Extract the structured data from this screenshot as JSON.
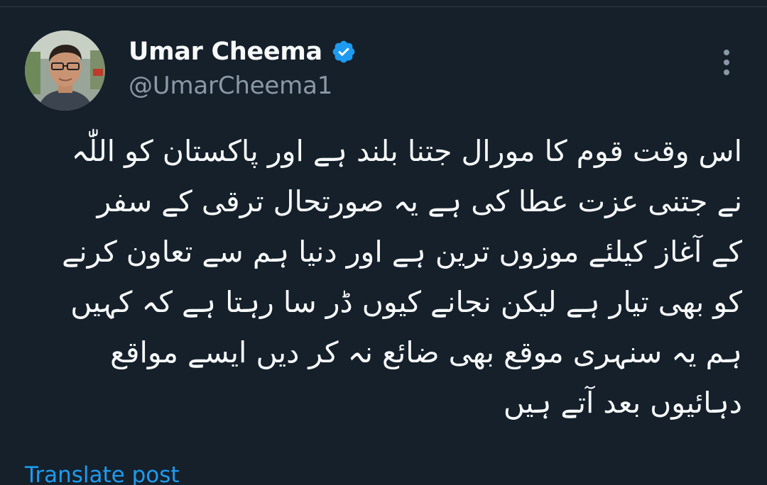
{
  "author": {
    "display_name": "Umar Cheema",
    "handle": "@UmarCheema1",
    "verified": true
  },
  "icons": {
    "verified": "verified-badge-icon",
    "more": "more-options-icon"
  },
  "colors": {
    "background": "#15202b",
    "text_primary": "#f7f9f9",
    "text_secondary": "#8b98a5",
    "accent": "#1d9bf0"
  },
  "tweet": {
    "lines": [
      "اس وقت قوم کا مورال جتنا بلند ہے اور پاکستان کو اللّٰہ",
      "نے جتنی عزت عطا کی ہے یہ صورتحال ترقی کے سفر",
      "کے آغاز کیلئے موزوں ترین ہے اور دنیا ہم سے تعاون کرنے",
      "کو بھی تیار ہے لیکن نجانے کیوں ڈر سا رہتا ہے کہ کہیں",
      "ہم یہ سنہری موقع بھی ضائع نہ کر دیں ایسے مواقع",
      "دہائیوں بعد آتے ہیں"
    ]
  },
  "actions": {
    "translate_label": "Translate post"
  }
}
